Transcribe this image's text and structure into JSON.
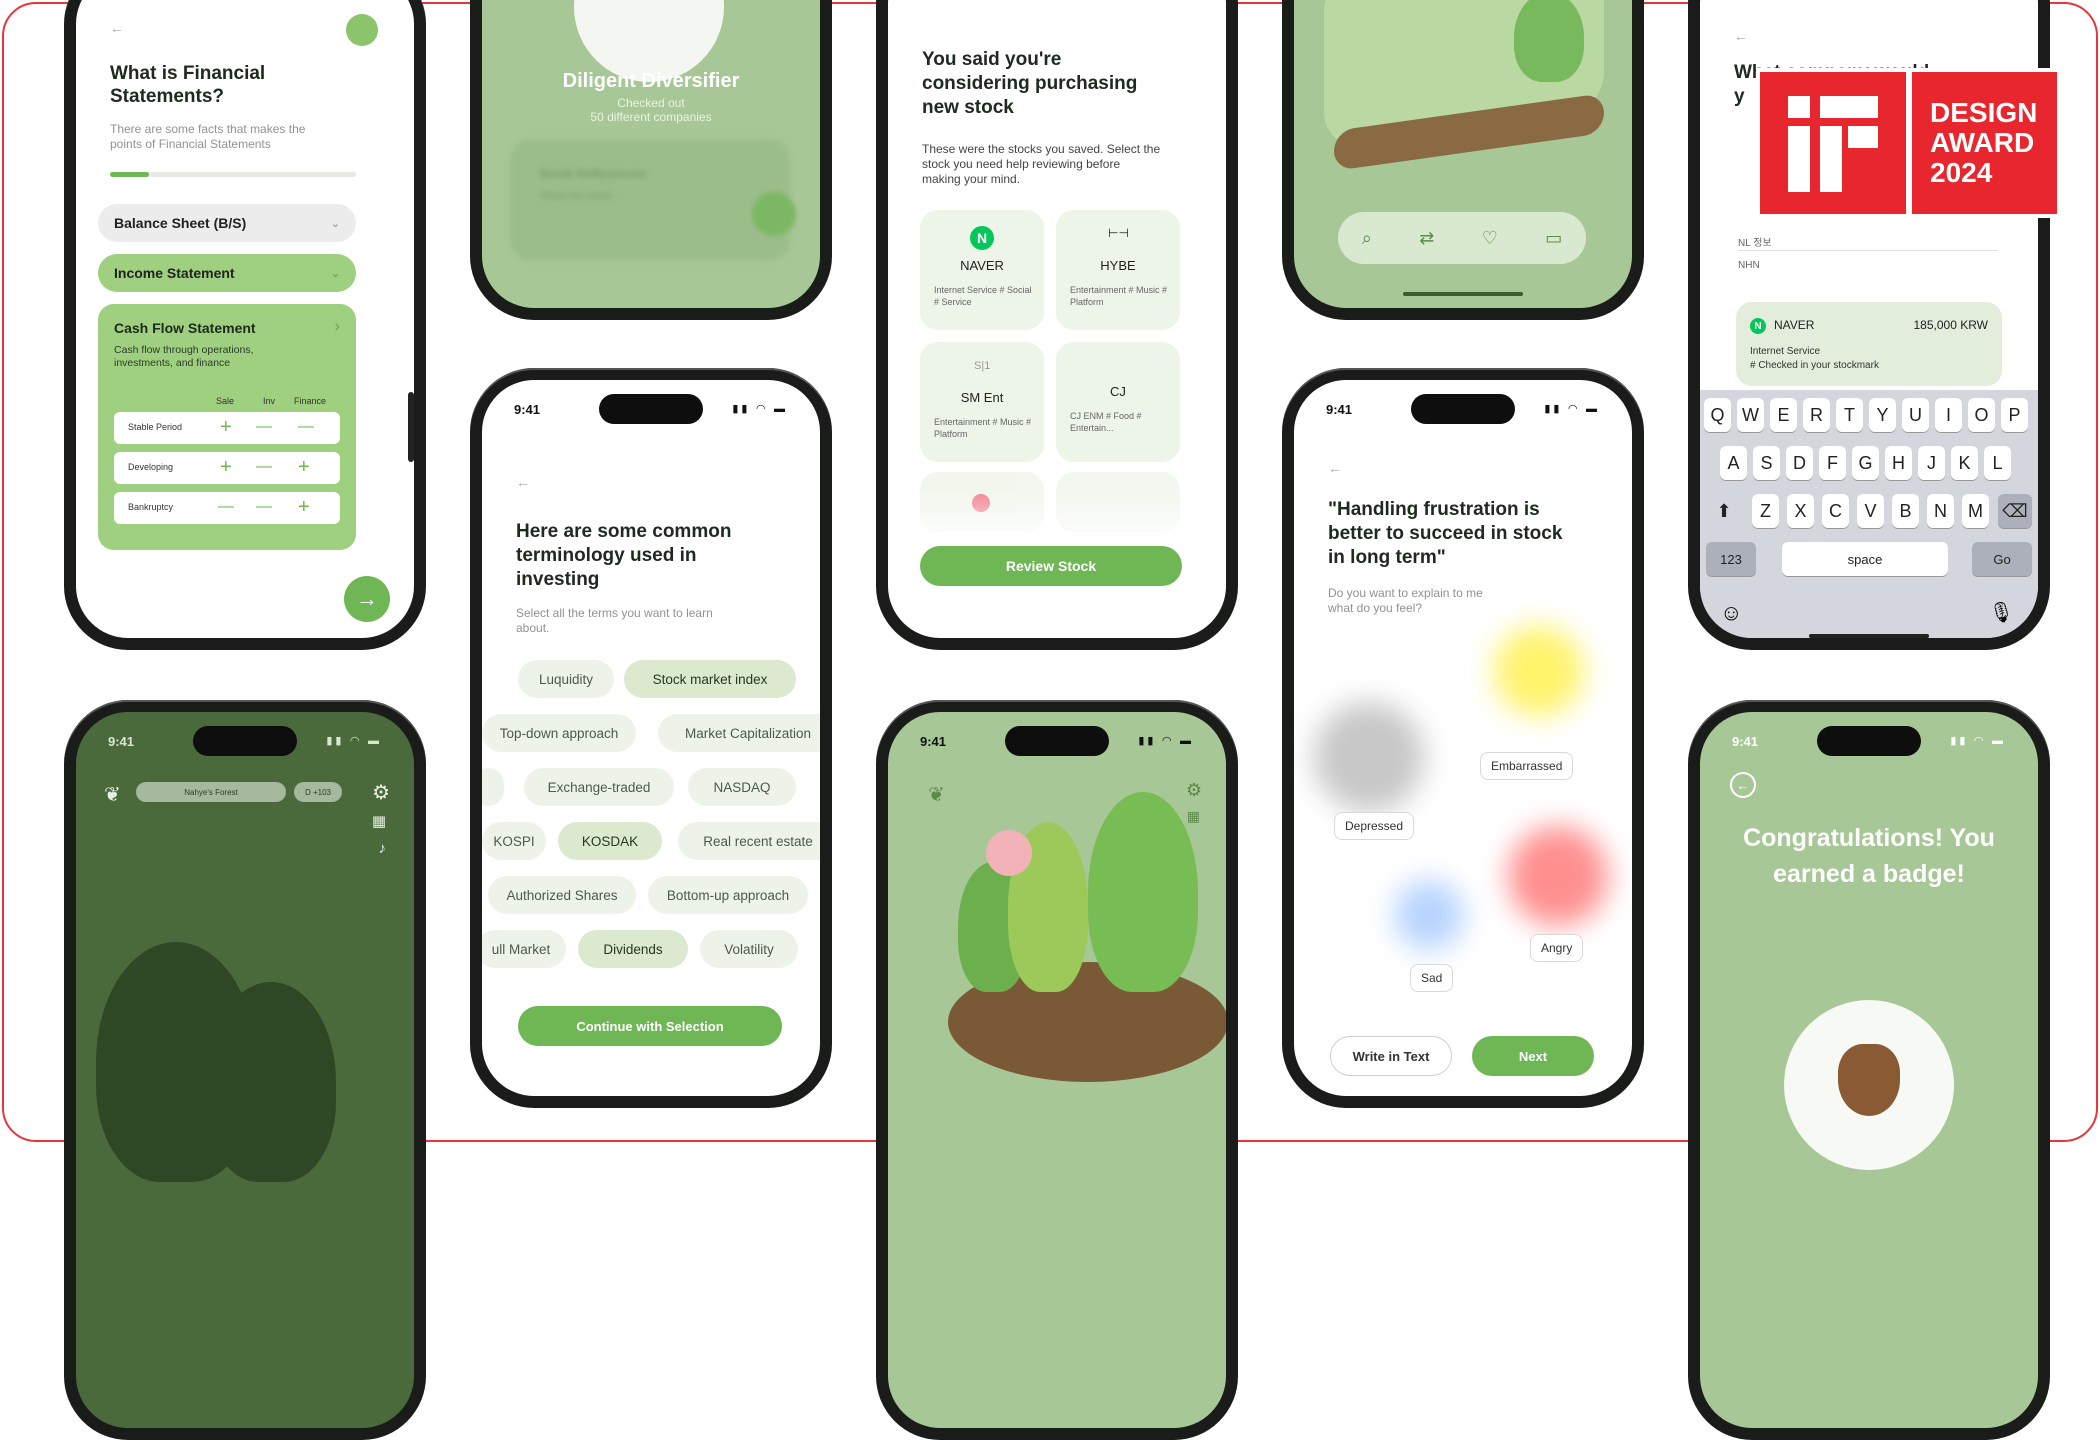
{
  "award": {
    "if_mark": "iF",
    "line1": "DESIGN",
    "line2": "AWARD",
    "line3": "2024"
  },
  "phone1": {
    "title": "What is Financial Statements?",
    "subtitle": "There are some facts that makes the points of Financial Statements",
    "progress": 0.16,
    "rows": [
      {
        "label": "Balance Sheet (B/S)"
      },
      {
        "label": "Income Statement"
      },
      {
        "label": "Cash Flow Statement"
      }
    ],
    "cash_flow_desc": "Cash flow through operations, investments, and finance",
    "table_headers": [
      "Sale",
      "Inv",
      "Finance"
    ],
    "table_rows": [
      {
        "label": "Stable Period",
        "signs": [
          "+",
          "—",
          "—"
        ]
      },
      {
        "label": "Developing",
        "signs": [
          "+",
          "—",
          "+"
        ]
      },
      {
        "label": "Bankruptcy",
        "signs": [
          "—",
          "—",
          "+"
        ]
      }
    ]
  },
  "phone2": {
    "badge_title": "Diligent Diversifier",
    "badge_desc_1": "Checked out",
    "badge_desc_2": "50 different companies",
    "blur_1": "Book References",
    "blur_2": "Read the book..."
  },
  "phone3": {
    "time": "9:41",
    "title": "Here are some common terminology used in investing",
    "subtitle": "Select all the terms you want to learn about.",
    "chips": [
      "Luquidity",
      "Stock market index",
      "Top-down approach",
      "Market Capitalization",
      "Exchange-traded",
      "NASDAQ",
      "KOSPI",
      "KOSDAK",
      "Real recent estate",
      "Authorized Shares",
      "Bottom-up approach",
      "ull Market",
      "Dividends",
      "Volatility"
    ],
    "button": "Continue with Selection"
  },
  "phone4": {
    "title": "You said you're considering purchasing new stock",
    "subtitle": "These were the stocks you saved. Select the stock you need help reviewing before making your mind.",
    "stocks": [
      {
        "name": "NAVER",
        "tags": "Internet Service # Social # Service"
      },
      {
        "name": "HYBE",
        "tags": "Entertainment # Music # Platform"
      },
      {
        "name": "SM Ent",
        "tags": "Entertainment # Music # Platform"
      },
      {
        "name": "CJ",
        "tags": "CJ ENM # Food # Entertain..."
      }
    ],
    "button": "Review Stock"
  },
  "phone5": {
    "time": "9:41"
  },
  "phone6": {
    "time": "9:41",
    "quote": "\"Handling frustration is better to succeed in stock in long term\"",
    "subtitle": "Do you want to explain to me what do you feel?",
    "moods": [
      "Embarrassed",
      "Depressed",
      "Angry",
      "Sad"
    ],
    "btn_text": "Write in Text",
    "btn_next": "Next"
  },
  "phone7": {
    "title_partial": "What company would",
    "title_partial2": "y",
    "company_kr": "NL 정보",
    "company_en": "NHN",
    "stock_name": "NAVER",
    "stock_price": "185,000 KRW",
    "stock_cat": "Internet Service",
    "stock_note": "# Checked in your stockmark",
    "keys_row1": [
      "Q",
      "W",
      "E",
      "R",
      "T",
      "Y",
      "U",
      "I",
      "O",
      "P"
    ],
    "keys_row2": [
      "A",
      "S",
      "D",
      "F",
      "G",
      "H",
      "J",
      "K",
      "L"
    ],
    "keys_row3": [
      "Z",
      "X",
      "C",
      "V",
      "B",
      "N",
      "M"
    ],
    "key_123": "123",
    "key_space": "space",
    "key_go": "Go"
  },
  "phone8": {
    "time": "9:41",
    "forest_name": "Nahye's Forest",
    "dday": "D +103"
  },
  "phone9": {
    "time": "9:41",
    "title": "Congratulations! You earned a badge!"
  }
}
